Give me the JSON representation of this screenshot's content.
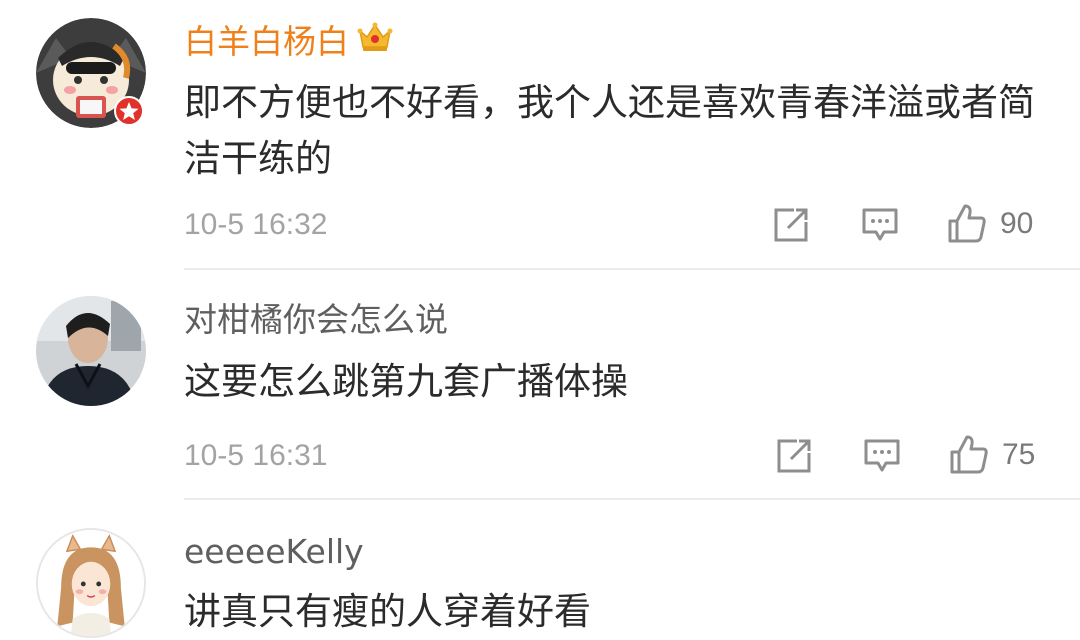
{
  "comments": [
    {
      "username": "白羊白杨白",
      "text": "即不方便也不好看，我个人还是喜欢青春洋溢或者简洁干练的",
      "time": "10-5 16:32",
      "likes": "90",
      "username_color": "#f0801a",
      "avatar_icon": "cartoon-cat-avatar",
      "badge_icon": "crown-icon"
    },
    {
      "username": "对柑橘你会怎么说",
      "text": "这要怎么跳第九套广播体操",
      "time": "10-5 16:31",
      "likes": "75",
      "username_color": "#5f5f5f",
      "avatar_icon": "person-photo-avatar"
    },
    {
      "username": "eeeeeKelly",
      "text": "讲真只有瘦的人穿着好看",
      "username_color": "#5f5f5f",
      "avatar_icon": "cartoon-girl-avatar"
    }
  ],
  "actions": {
    "share_icon": "share-icon",
    "reply_icon": "comment-icon",
    "like_icon": "thumbs-up-icon"
  }
}
